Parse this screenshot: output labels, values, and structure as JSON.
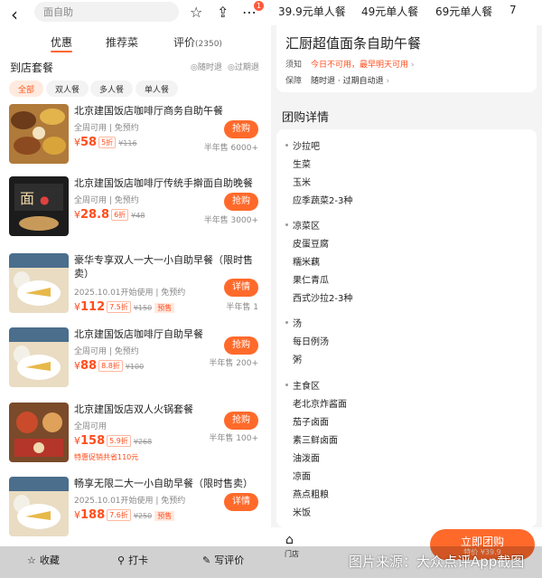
{
  "left": {
    "search_placeholder": "面自助",
    "badge": "1",
    "tabs": [
      "优惠",
      "推荐菜",
      "评价",
      "(2350)"
    ],
    "section_title": "到店套餐",
    "section_tags": [
      "◎随时退",
      "◎过期退"
    ],
    "chips": [
      "全部",
      "双人餐",
      "多人餐",
      "单人餐"
    ],
    "items": [
      {
        "title": "北京建国饭店咖啡厅商务自助午餐",
        "sub": "全周可用 | 免预约",
        "currency": "¥",
        "price": "58",
        "discount": "5折",
        "orig": "¥116",
        "tag": "",
        "button": "抢购",
        "sold": "半年售 6000+",
        "promo": ""
      },
      {
        "title": "北京建国饭店咖啡厅传统手擀面自助晚餐",
        "sub": "全周可用 | 免预约",
        "currency": "¥",
        "price": "28.8",
        "discount": "6折",
        "orig": "¥48",
        "tag": "",
        "button": "抢购",
        "sold": "半年售 3000+",
        "promo": ""
      },
      {
        "title": "豪华专享双人一大一小自助早餐（限时售卖）",
        "sub": "2025.10.01开始使用 | 免预约",
        "currency": "¥",
        "price": "112",
        "discount": "7.5折",
        "orig": "¥150",
        "tag": "预售",
        "button": "详情",
        "sold": "半年售 1",
        "promo": ""
      },
      {
        "title": "北京建国饭店咖啡厅自助早餐",
        "sub": "全周可用 | 免预约",
        "currency": "¥",
        "price": "88",
        "discount": "8.8折",
        "orig": "¥100",
        "tag": "",
        "button": "抢购",
        "sold": "半年售 200+",
        "promo": ""
      },
      {
        "title": "北京建国饭店双人火锅套餐",
        "sub": "全周可用",
        "currency": "¥",
        "price": "158",
        "discount": "5.9折",
        "orig": "¥268",
        "tag": "",
        "button": "抢购",
        "sold": "半年售 100+",
        "promo": "特惠促销共省110元"
      },
      {
        "title": "畅享无限二大一小自助早餐（限时售卖）",
        "sub": "2025.10.01开始使用 | 免预约",
        "currency": "¥",
        "price": "188",
        "discount": "7.6折",
        "orig": "¥250",
        "tag": "预售",
        "button": "详情",
        "sold": "",
        "promo": ""
      }
    ],
    "bottom": [
      "收藏",
      "打卡",
      "写评价"
    ]
  },
  "right": {
    "tabs": [
      "39.9元单人餐",
      "49元单人餐",
      "69元单人餐",
      "7"
    ],
    "title": "汇厨超值面条自助午餐",
    "notice_label": "须知",
    "notice_value": "今日不可用，最早明天可用",
    "guarantee_label": "保障",
    "guarantee_value": "随时退 · 过期自动退",
    "detail_heading": "团购详情",
    "groups": [
      {
        "name": "沙拉吧",
        "items": [
          "生菜",
          "玉米",
          "应季蔬菜2-3种"
        ]
      },
      {
        "name": "凉菜区",
        "items": [
          "皮蛋豆腐",
          "糯米藕",
          "果仁青瓜",
          "西式沙拉2-3种"
        ]
      },
      {
        "name": "汤",
        "items": [
          "每日例汤",
          "粥"
        ]
      },
      {
        "name": "主食区",
        "items": [
          "老北京炸酱面",
          "茄子卤面",
          "素三鲜卤面",
          "油泼面",
          "凉面",
          "燕点粗粮",
          "米饭"
        ]
      }
    ],
    "store_label": "门店",
    "buy_label": "立即团购",
    "buy_price": "¥39.9",
    "buy_price_prefix": "特价"
  },
  "credit": "图片来源：大众点评App截图",
  "colors": {
    "accent": "#ff6a2b",
    "price": "#ff4d1c"
  }
}
